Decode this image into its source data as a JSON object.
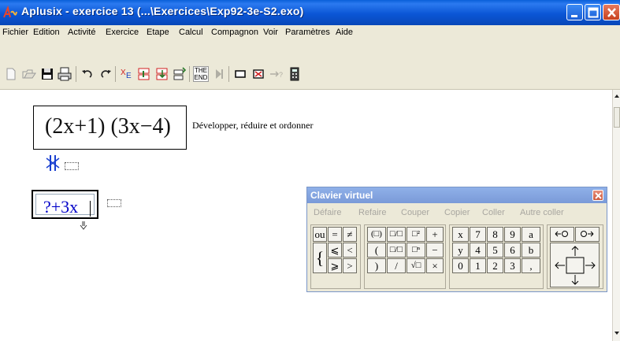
{
  "window": {
    "title": "Aplusix - exercice 13  (...\\Exercices\\Exp92-3e-S2.exo)",
    "app_icon": "aplusix-logo-icon",
    "controls": [
      "minimize-icon",
      "maximize-icon",
      "close-icon"
    ]
  },
  "menu": [
    {
      "label": "Fichier"
    },
    {
      "label": "Edition"
    },
    {
      "label": "Activité"
    },
    {
      "label": "Exercice"
    },
    {
      "label": "Etape"
    },
    {
      "label": "Calcul"
    },
    {
      "label": "Compagnon"
    },
    {
      "label": "Voir"
    },
    {
      "label": "Paramètres"
    },
    {
      "label": "Aide"
    }
  ],
  "toolbar": {
    "end_button": {
      "line1": "THE",
      "line2": "END"
    },
    "icons": [
      "new-file-icon",
      "open-file-icon",
      "save-icon",
      "print-icon",
      "undo-icon",
      "redo-icon",
      "check-icon",
      "step-back-icon",
      "step-add-icon",
      "step-next-icon",
      "end-icon",
      "play-icon",
      "rectangle-icon",
      "cross-box-icon",
      "equivalence-icon",
      "calculator-icon"
    ]
  },
  "exercise": {
    "expression": "(2x+1) (3x−4)",
    "instruction": "Développer, réduire et ordonner",
    "current_input": "?+3x"
  },
  "virtual_keyboard": {
    "title": "Clavier virtuel",
    "menu": [
      "Défaire",
      "Refaire",
      "Couper",
      "Copier",
      "Coller",
      "Autre coller"
    ],
    "row1_logic": [
      "ou",
      "=",
      "≠"
    ],
    "row2_logic": [
      "⩽",
      "<"
    ],
    "row3_logic": [
      "⩾",
      ">"
    ],
    "row1_struct": [
      "(□)",
      "□/□",
      "□²",
      "+"
    ],
    "row2_struct": [
      "(",
      "□/□",
      "□ⁿ",
      "−"
    ],
    "row3_struct": [
      ")",
      "/",
      "√□",
      "×"
    ],
    "row1_digits": [
      "x",
      "7",
      "8",
      "9",
      "a"
    ],
    "row2_digits": [
      "y",
      "4",
      "5",
      "6",
      "b"
    ],
    "row3_digits": [
      "0",
      "1",
      "2",
      "3",
      ","
    ],
    "brace": "{"
  }
}
